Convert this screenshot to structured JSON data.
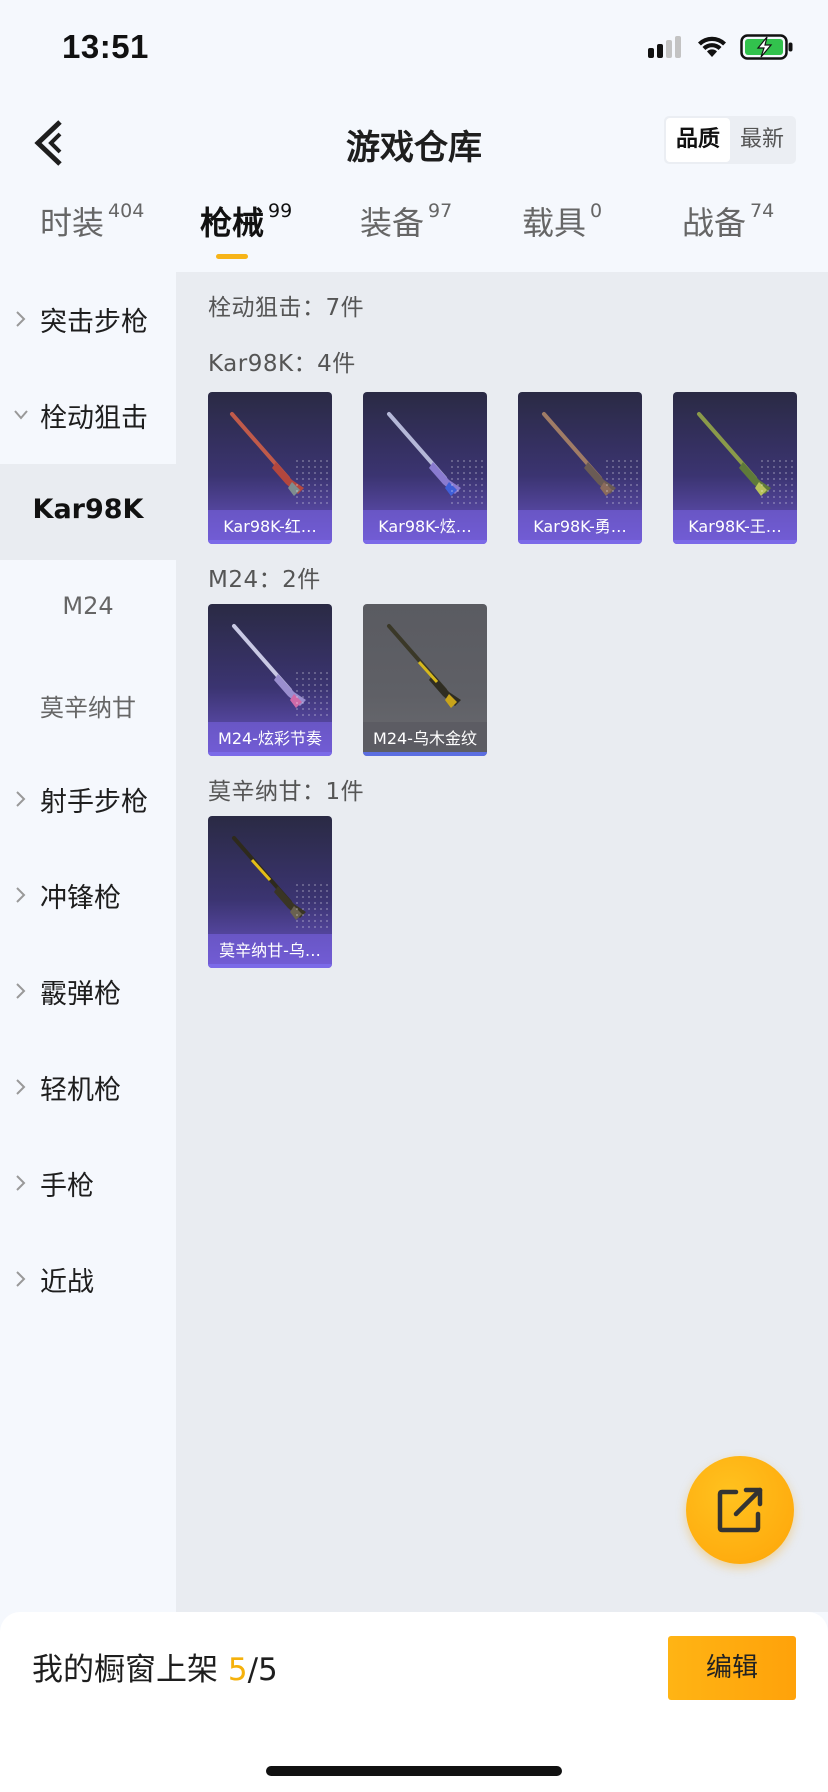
{
  "status": {
    "time": "13:51"
  },
  "header": {
    "title": "游戏仓库",
    "sort_quality": "品质",
    "sort_newest": "最新"
  },
  "tabs": [
    {
      "label": "时装",
      "count": "404"
    },
    {
      "label": "枪械",
      "count": "99"
    },
    {
      "label": "装备",
      "count": "97"
    },
    {
      "label": "载具",
      "count": "0"
    },
    {
      "label": "战备",
      "count": "74"
    }
  ],
  "sidebar": [
    {
      "label": "突击步枪"
    },
    {
      "label": "栓动狙击"
    },
    {
      "label": "Kar98K"
    },
    {
      "label": "M24"
    },
    {
      "label": "莫辛纳甘"
    },
    {
      "label": "射手步枪"
    },
    {
      "label": "冲锋枪"
    },
    {
      "label": "霰弹枪"
    },
    {
      "label": "轻机枪"
    },
    {
      "label": "手枪"
    },
    {
      "label": "近战"
    }
  ],
  "main": {
    "category_total": "栓动狙击：7件",
    "groups": [
      {
        "label": "Kar98K：4件",
        "items": [
          "Kar98K-红…",
          "Kar98K-炫…",
          "Kar98K-勇…",
          "Kar98K-王…"
        ]
      },
      {
        "label": "M24：2件",
        "items": [
          "M24-炫彩节奏",
          "M24-乌木金纹"
        ]
      },
      {
        "label": "莫辛纳甘：1件",
        "items": [
          "莫辛纳甘-乌…"
        ]
      }
    ]
  },
  "bottom": {
    "shop_text": "我的橱窗上架 ",
    "shop_current": "5",
    "shop_total": "/5",
    "edit_label": "编辑"
  }
}
